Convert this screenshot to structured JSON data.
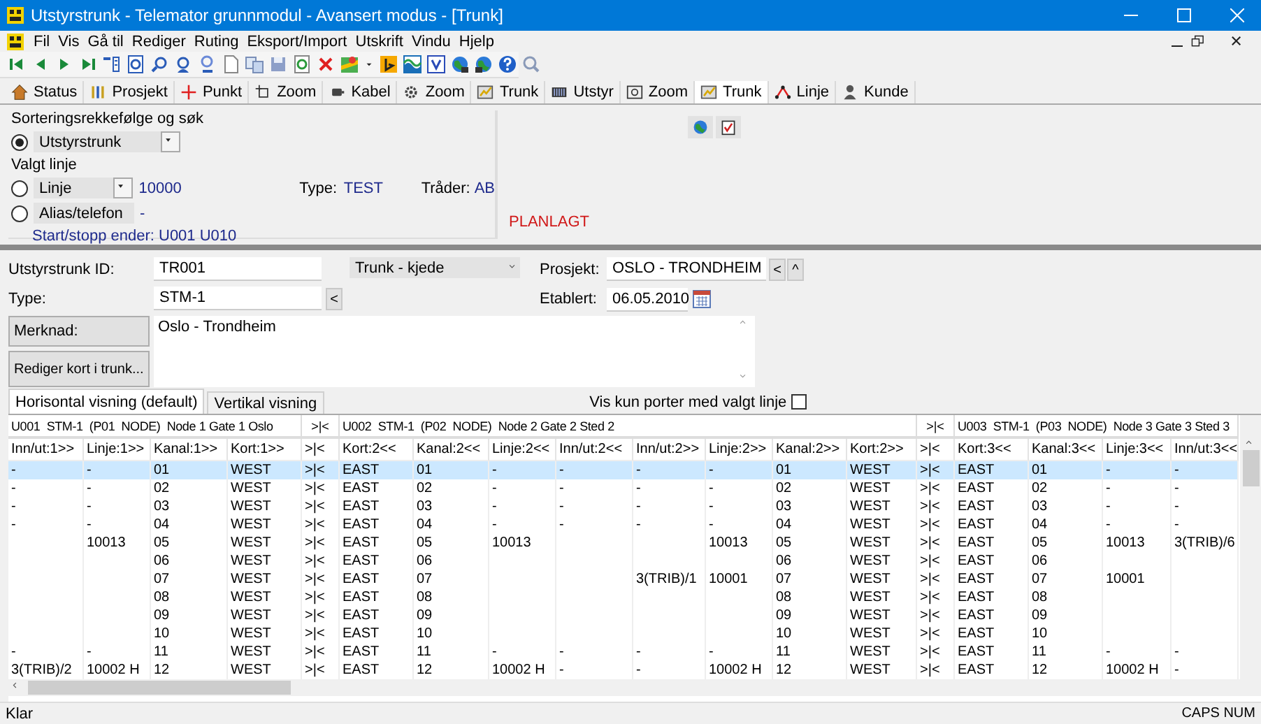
{
  "window": {
    "title": "Utstyrstrunk - Telemator grunnmodul - Avansert modus - [Trunk]"
  },
  "menu": [
    "Fil",
    "Vis",
    "Gå til",
    "Rediger",
    "Ruting",
    "Eksport/Import",
    "Utskrift",
    "Vindu",
    "Hjelp"
  ],
  "nav": [
    {
      "label": "Status",
      "selected": false
    },
    {
      "label": "Prosjekt",
      "selected": false
    },
    {
      "label": "Punkt",
      "selected": false
    },
    {
      "label": "Zoom",
      "selected": false
    },
    {
      "label": "Kabel",
      "selected": false
    },
    {
      "label": "Zoom",
      "selected": false
    },
    {
      "label": "Trunk",
      "selected": false
    },
    {
      "label": "Utstyr",
      "selected": false
    },
    {
      "label": "Zoom",
      "selected": false
    },
    {
      "label": "Trunk",
      "selected": true
    },
    {
      "label": "Linje",
      "selected": false
    },
    {
      "label": "Kunde",
      "selected": false
    }
  ],
  "search": {
    "title": "Sorteringsrekkefølge og søk",
    "sort_option": {
      "label": "Utstyrstrunk",
      "selected": true
    },
    "line_title": "Valgt linje",
    "line_option": {
      "label": "Linje",
      "selected": false
    },
    "line_value": "10000",
    "type_label": "Type:",
    "type_value": "TEST",
    "threads_label": "Tråder:",
    "threads_value": "AB",
    "alias_option": {
      "label": "Alias/telefon",
      "selected": false
    },
    "alias_value": "-",
    "ends": "Start/stopp ender: U001  U010",
    "status": "PLANLAGT"
  },
  "form": {
    "id_label": "Utstyrstrunk ID:",
    "id_value": "TR001",
    "type_label": "Type:",
    "type_value": "STM-1",
    "type_button": "<",
    "chain": "Trunk - kjede",
    "project_label": "Prosjekt:",
    "project_value": "OSLO - TRONDHEIM",
    "project_buttons": [
      "<",
      "^"
    ],
    "established_label": "Etablert:",
    "established_value": "06.05.2010",
    "note_button": "Merknad:",
    "note_value": "Oslo - Trondheim",
    "edit_button": "Rediger kort i trunk..."
  },
  "view_tabs": [
    {
      "label": "Horisontal visning (default)",
      "selected": true
    },
    {
      "label": "Vertikal visning",
      "selected": false
    }
  ],
  "filter": {
    "label": "Vis kun porter med valgt linje",
    "checked": false
  },
  "grid": {
    "groups": [
      {
        "kind": "group",
        "label": "U001  STM-1  (P01  NODE)  Node 1 Gate 1 Oslo"
      },
      {
        "kind": "join",
        "label": ">|<"
      },
      {
        "kind": "group",
        "label": "U002  STM-1  (P02  NODE)  Node 2 Gate 2 Sted 2"
      },
      {
        "kind": "join",
        "label": ">|<"
      },
      {
        "kind": "group",
        "label": "U003  STM-1  (P03  NODE)  Node 3 Gate 3 Sted 3"
      }
    ],
    "columns": [
      {
        "kind": "data",
        "label": "Inn/ut:1>>"
      },
      {
        "kind": "data",
        "label": "Linje:1>>"
      },
      {
        "kind": "data",
        "label": "Kanal:1>>"
      },
      {
        "kind": "data",
        "label": "Kort:1>>"
      },
      {
        "kind": "join",
        "label": ">|<"
      },
      {
        "kind": "data",
        "label": "Kort:2<<"
      },
      {
        "kind": "data",
        "label": "Kanal:2<<"
      },
      {
        "kind": "data",
        "label": "Linje:2<<"
      },
      {
        "kind": "data",
        "label": "Inn/ut:2<<"
      },
      {
        "kind": "data",
        "label": "Inn/ut:2>>"
      },
      {
        "kind": "data",
        "label": "Linje:2>>"
      },
      {
        "kind": "data",
        "label": "Kanal:2>>"
      },
      {
        "kind": "data",
        "label": "Kort:2>>"
      },
      {
        "kind": "join",
        "label": ">|<"
      },
      {
        "kind": "data",
        "label": "Kort:3<<"
      },
      {
        "kind": "data",
        "label": "Kanal:3<<"
      },
      {
        "kind": "data",
        "label": "Linje:3<<"
      },
      {
        "kind": "data",
        "label": "Inn/ut:3<<"
      }
    ],
    "rows": [
      {
        "selected": true,
        "cells": [
          "-",
          "-",
          "01",
          "WEST",
          ">|<",
          "EAST",
          "01",
          "-",
          "-",
          "-",
          "-",
          "01",
          "WEST",
          ">|<",
          "EAST",
          "01",
          "-",
          "-"
        ]
      },
      {
        "selected": false,
        "cells": [
          "-",
          "-",
          "02",
          "WEST",
          ">|<",
          "EAST",
          "02",
          "-",
          "-",
          "-",
          "-",
          "02",
          "WEST",
          ">|<",
          "EAST",
          "02",
          "-",
          "-"
        ]
      },
      {
        "selected": false,
        "cells": [
          "-",
          "-",
          "03",
          "WEST",
          ">|<",
          "EAST",
          "03",
          "-",
          "-",
          "-",
          "-",
          "03",
          "WEST",
          ">|<",
          "EAST",
          "03",
          "-",
          "-"
        ]
      },
      {
        "selected": false,
        "cells": [
          "-",
          "-",
          "04",
          "WEST",
          ">|<",
          "EAST",
          "04",
          "-",
          "-",
          "-",
          "-",
          "04",
          "WEST",
          ">|<",
          "EAST",
          "04",
          "-",
          "-"
        ]
      },
      {
        "selected": false,
        "cells": [
          "",
          "10013",
          "05",
          "WEST",
          ">|<",
          "EAST",
          "05",
          "10013",
          "",
          "",
          "10013",
          "05",
          "WEST",
          ">|<",
          "EAST",
          "05",
          "10013",
          "3(TRIB)/6"
        ]
      },
      {
        "selected": false,
        "cells": [
          "",
          "",
          "06",
          "WEST",
          ">|<",
          "EAST",
          "06",
          "",
          "",
          "",
          "",
          "06",
          "WEST",
          ">|<",
          "EAST",
          "06",
          "",
          ""
        ]
      },
      {
        "selected": false,
        "cells": [
          "",
          "",
          "07",
          "WEST",
          ">|<",
          "EAST",
          "07",
          "",
          "",
          "3(TRIB)/1",
          "10001",
          "07",
          "WEST",
          ">|<",
          "EAST",
          "07",
          "10001",
          ""
        ]
      },
      {
        "selected": false,
        "cells": [
          "",
          "",
          "08",
          "WEST",
          ">|<",
          "EAST",
          "08",
          "",
          "",
          "",
          "",
          "08",
          "WEST",
          ">|<",
          "EAST",
          "08",
          "",
          ""
        ]
      },
      {
        "selected": false,
        "cells": [
          "",
          "",
          "09",
          "WEST",
          ">|<",
          "EAST",
          "09",
          "",
          "",
          "",
          "",
          "09",
          "WEST",
          ">|<",
          "EAST",
          "09",
          "",
          ""
        ]
      },
      {
        "selected": false,
        "cells": [
          "",
          "",
          "10",
          "WEST",
          ">|<",
          "EAST",
          "10",
          "",
          "",
          "",
          "",
          "10",
          "WEST",
          ">|<",
          "EAST",
          "10",
          "",
          ""
        ]
      },
      {
        "selected": false,
        "cells": [
          "-",
          "-",
          "11",
          "WEST",
          ">|<",
          "EAST",
          "11",
          "-",
          "-",
          "-",
          "-",
          "11",
          "WEST",
          ">|<",
          "EAST",
          "11",
          "-",
          "-"
        ]
      },
      {
        "selected": false,
        "cells": [
          "3(TRIB)/2",
          "10002 H",
          "12",
          "WEST",
          ">|<",
          "EAST",
          "12",
          "10002 H",
          "-",
          "-",
          "10002 H",
          "12",
          "WEST",
          ">|<",
          "EAST",
          "12",
          "10002 H",
          "-"
        ]
      }
    ]
  },
  "status_bar": {
    "message": "Klar",
    "indicators": "CAPS NUM"
  }
}
